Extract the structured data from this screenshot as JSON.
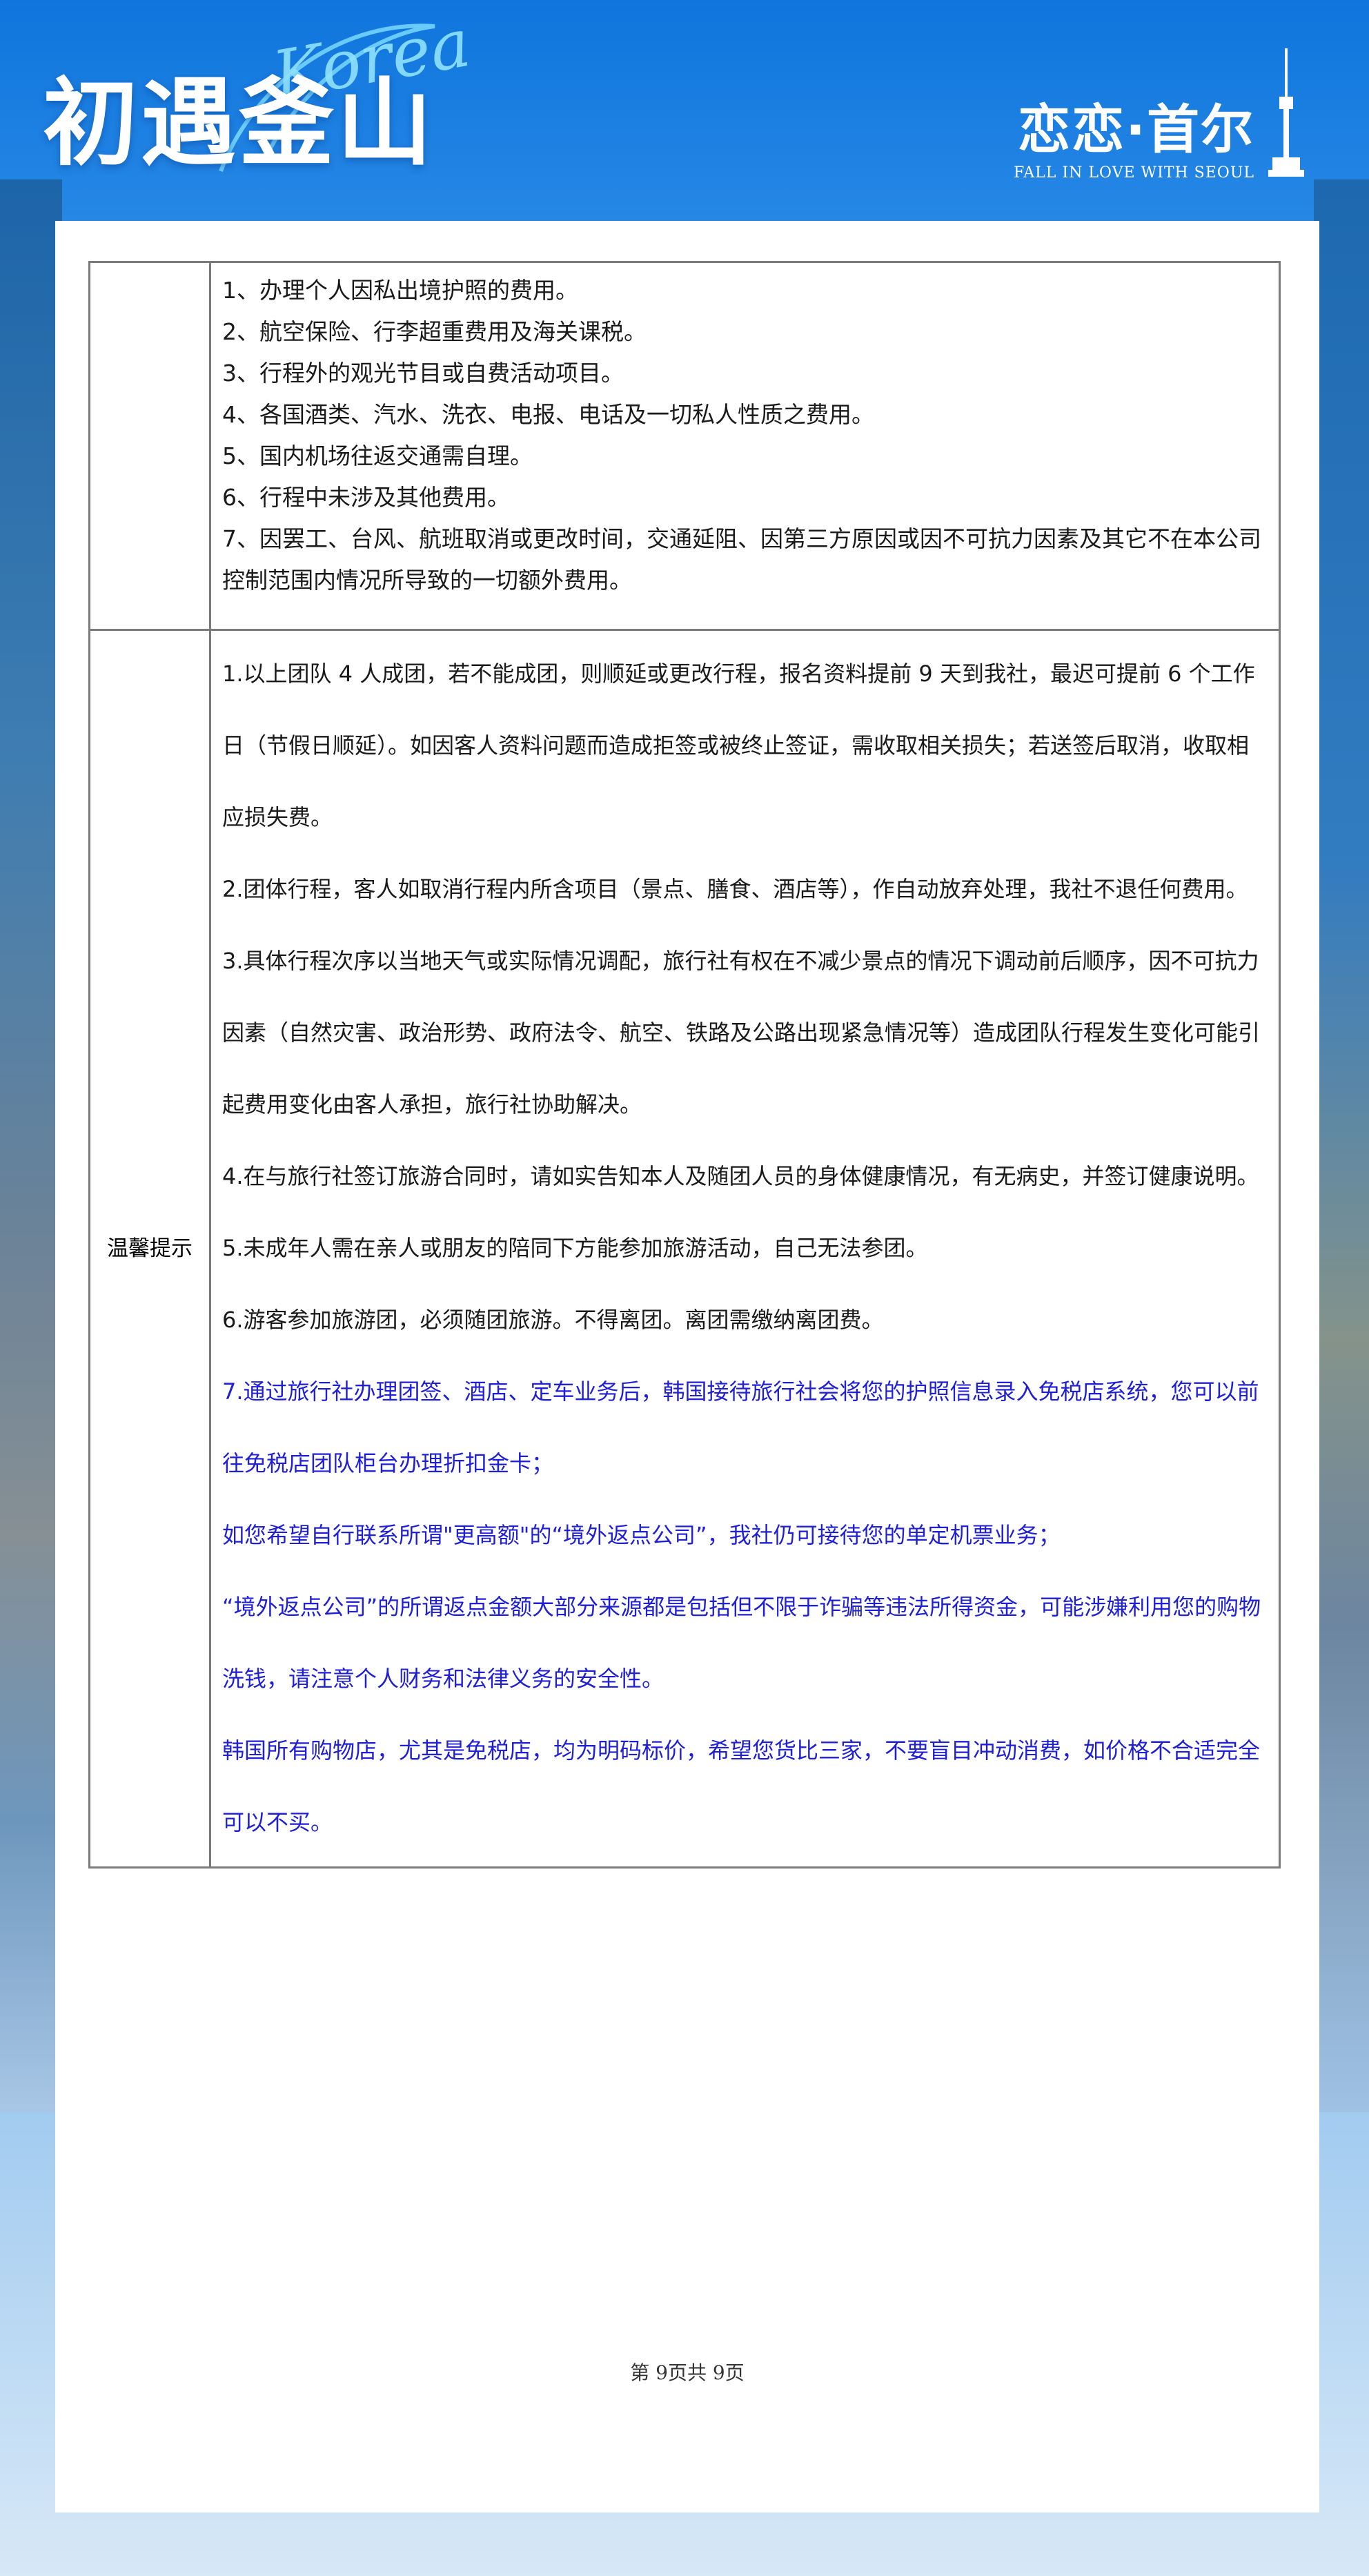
{
  "header": {
    "logo_title": "初遇釜山",
    "logo_script": "Korea",
    "brand_cn": "恋恋·首尔",
    "brand_en": "FALL IN LOVE WITH SEOUL"
  },
  "fee_exclusions": [
    "1、办理个人因私出境护照的费用。",
    "2、航空保险、行李超重费用及海关课税。",
    "3、行程外的观光节目或自费活动项目。",
    "4、各国酒类、汽水、洗衣、电报、电话及一切私人性质之费用。",
    "5、国内机场往返交通需自理。",
    "6、行程中未涉及其他费用。",
    "7、因罢工、台风、航班取消或更改时间，交通延阻、因第三方原因或因不可抗力因素及其它不在本公司控制范围内情况所导致的一切额外费用。"
  ],
  "tips_label": "温馨提示",
  "tips": [
    "1.以上团队 4 人成团，若不能成团，则顺延或更改行程，报名资料提前 9 天到我社，最迟可提前 6 个工作日（节假日顺延）。如因客人资料问题而造成拒签或被终止签证，需收取相关损失；若送签后取消，收取相应损失费。",
    "2.团体行程，客人如取消行程内所含项目（景点、膳食、酒店等），作自动放弃处理，我社不退任何费用。",
    "3.具体行程次序以当地天气或实际情况调配，旅行社有权在不减少景点的情况下调动前后顺序，因不可抗力因素（自然灾害、政治形势、政府法令、航空、铁路及公路出现紧急情况等）造成团队行程发生变化可能引起费用变化由客人承担，旅行社协助解决。",
    "4.在与旅行社签订旅游合同时，请如实告知本人及随团人员的身体健康情况，有无病史，并签订健康说明。",
    "5.未成年人需在亲人或朋友的陪同下方能参加旅游活动，自己无法参团。",
    "6.游客参加旅游团，必须随团旅游。不得离团。离团需缴纳离团费。"
  ],
  "tips_blue": [
    "7.通过旅行社办理团签、酒店、定车业务后，韩国接待旅行社会将您的护照信息录入免税店系统，您可以前往免税店团队柜台办理折扣金卡；",
    "如您希望自行联系所谓\"更高额\"的“境外返点公司”，我社仍可接待您的单定机票业务；",
    "“境外返点公司”的所谓返点金额大部分来源都是包括但不限于诈骗等违法所得资金，可能涉嫌利用您的购物洗钱，请注意个人财务和法律义务的安全性。",
    "韩国所有购物店，尤其是免税店，均为明码标价，希望您货比三家，不要盲目冲动消费，如价格不合适完全可以不买。"
  ],
  "footer": {
    "page_text": "第 9页共 9页"
  }
}
